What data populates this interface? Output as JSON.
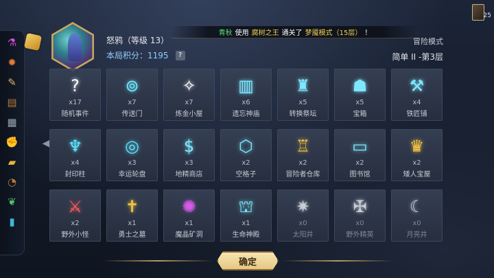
{
  "top_right": {
    "card_count": "25"
  },
  "banner": {
    "player": "青秋",
    "use": "使用",
    "hero": "腐树之王",
    "cleared": "通关了",
    "mode": "梦魇模式（15层）",
    "bang": "！"
  },
  "hero": {
    "name": "怒鸦（等级 13）",
    "score_label": "本局积分：",
    "score": "1195",
    "help": "?"
  },
  "run": {
    "mode": "冒险模式",
    "difficulty": "简单 II -第3层"
  },
  "sidebar": {
    "items": [
      {
        "icon": "potion-icon",
        "glyph": "⚗",
        "color": "#d14fd8"
      },
      {
        "icon": "gem-badge-icon",
        "glyph": "✹",
        "color": "#e07b3a"
      },
      {
        "icon": "scroll-icon",
        "glyph": "✎",
        "color": "#d9b56a"
      },
      {
        "icon": "book-icon",
        "glyph": "▤",
        "color": "#b27a3f"
      },
      {
        "icon": "stone-tablet-icon",
        "glyph": "▦",
        "color": "#9aa3b0"
      },
      {
        "icon": "gauntlet-icon",
        "glyph": "✊",
        "color": "#8a93a3"
      },
      {
        "icon": "gold-bars-icon",
        "glyph": "▰",
        "color": "#e6b532"
      },
      {
        "icon": "horn-icon",
        "glyph": "◔",
        "color": "#b57a3c"
      },
      {
        "icon": "leaf-icon",
        "glyph": "❦",
        "color": "#52c46a"
      },
      {
        "icon": "card-icon",
        "glyph": "▮",
        "color": "#3fb6d6"
      }
    ]
  },
  "cells": [
    {
      "icon": "question-mark-icon",
      "glyph": "?",
      "color": "#ffffff",
      "count": "x17",
      "label": "随机事件",
      "dim": false
    },
    {
      "icon": "portal-icon",
      "glyph": "⊚",
      "color": "#6de7ff",
      "count": "x7",
      "label": "传送门",
      "dim": false
    },
    {
      "icon": "alchemy-hut-icon",
      "glyph": "✧",
      "color": "#ffffff",
      "count": "x7",
      "label": "炼金小屋",
      "dim": false
    },
    {
      "icon": "forgotten-temple-icon",
      "glyph": "▥",
      "color": "#7ee8ff",
      "count": "x6",
      "label": "遗忘神庙",
      "dim": false
    },
    {
      "icon": "transform-altar-icon",
      "glyph": "♜",
      "color": "#7ee8ff",
      "count": "x5",
      "label": "转换祭坛",
      "dim": false
    },
    {
      "icon": "treasure-chest-icon",
      "glyph": "☗",
      "color": "#7ee8ff",
      "count": "x5",
      "label": "宝箱",
      "dim": false
    },
    {
      "icon": "anvil-icon",
      "glyph": "⚒",
      "color": "#7ee8ff",
      "count": "x4",
      "label": "铁匠铺",
      "dim": false
    },
    {
      "icon": "seal-pillar-icon",
      "glyph": "♆",
      "color": "#5fe4ff",
      "count": "x4",
      "label": "封印柱",
      "dim": false
    },
    {
      "icon": "lucky-wheel-icon",
      "glyph": "◎",
      "color": "#5fe4ff",
      "count": "x3",
      "label": "幸运轮盘",
      "dim": false
    },
    {
      "icon": "elf-shop-icon",
      "glyph": "$",
      "color": "#7ee8ff",
      "count": "x3",
      "label": "地精商店",
      "dim": false
    },
    {
      "icon": "empty-cell-icon",
      "glyph": "⬡",
      "color": "#7ee8ff",
      "count": "x2",
      "label": "空格子",
      "dim": false
    },
    {
      "icon": "adventurer-storehouse-icon",
      "glyph": "♖",
      "color": "#f0c043",
      "count": "x2",
      "label": "冒险者仓库",
      "dim": false
    },
    {
      "icon": "library-icon",
      "glyph": "▭",
      "color": "#7ee8ff",
      "count": "x2",
      "label": "图书馆",
      "dim": false
    },
    {
      "icon": "dwarf-treasure-icon",
      "glyph": "♛",
      "color": "#f0c043",
      "count": "x2",
      "label": "矮人宝屋",
      "dim": false
    },
    {
      "icon": "crossed-swords-icon",
      "glyph": "⚔",
      "color": "#ff5a5a",
      "count": "x2",
      "label": "野外小怪",
      "dim": false
    },
    {
      "icon": "tomb-icon",
      "glyph": "✝",
      "color": "#f0c043",
      "count": "x1",
      "label": "勇士之墓",
      "dim": false
    },
    {
      "icon": "magic-crystal-cave-icon",
      "glyph": "✺",
      "color": "#d45be8",
      "count": "x1",
      "label": "魔晶矿洞",
      "dim": false
    },
    {
      "icon": "life-temple-icon",
      "glyph": "⛫",
      "color": "#7ee8ff",
      "count": "x1",
      "label": "生命神殿",
      "dim": false
    },
    {
      "icon": "sun-well-icon",
      "glyph": "✷",
      "color": "#e3e6ee",
      "count": "x0",
      "label": "太阳井",
      "dim": true
    },
    {
      "icon": "elite-axes-icon",
      "glyph": "✠",
      "color": "#e3e6ee",
      "count": "x0",
      "label": "野外精英",
      "dim": true
    },
    {
      "icon": "moon-well-icon",
      "glyph": "☾",
      "color": "#e3e6ee",
      "count": "x0",
      "label": "月亮井",
      "dim": true
    }
  ],
  "confirm": {
    "label": "确定"
  }
}
